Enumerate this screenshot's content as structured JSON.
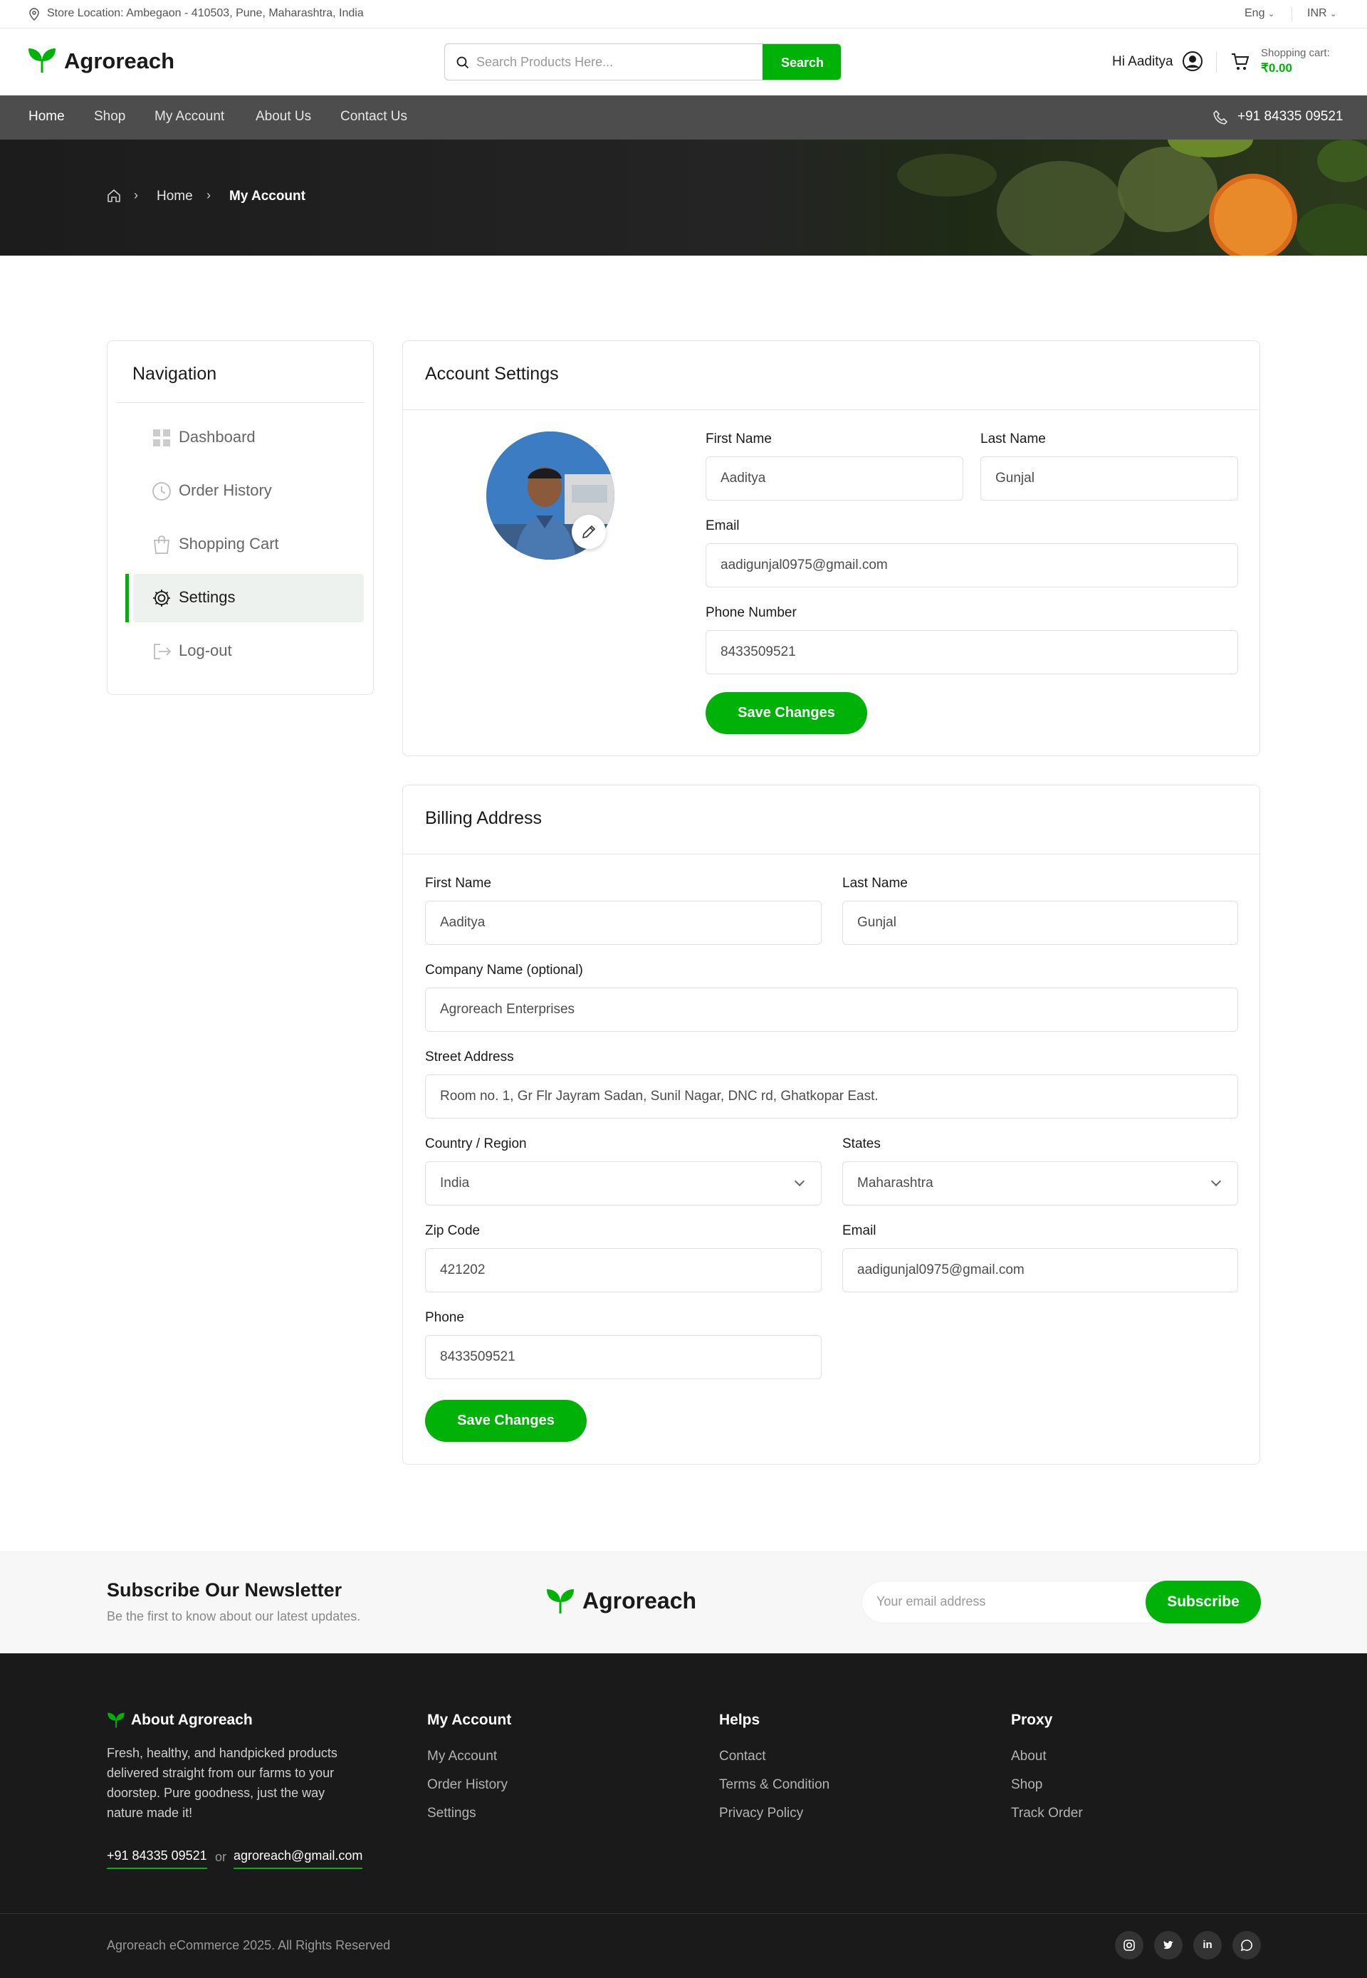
{
  "topbar": {
    "store_location": "Store Location: Ambegaon - 410503, Pune, Maharashtra, India",
    "language": "Eng",
    "currency": "INR"
  },
  "header": {
    "brand": "Agroreach",
    "search_placeholder": "Search Products Here...",
    "search_button": "Search",
    "greeting": "Hi Aaditya",
    "cart_label": "Shopping cart:",
    "cart_total": "₹0.00"
  },
  "nav": {
    "items": [
      "Home",
      "Shop",
      "My Account",
      "About Us",
      "Contact Us"
    ],
    "phone": "+91 84335 09521"
  },
  "breadcrumb": {
    "home": "Home",
    "current": "My Account"
  },
  "sidebar": {
    "title": "Navigation",
    "items": [
      {
        "label": "Dashboard",
        "icon": "dashboard-icon"
      },
      {
        "label": "Order History",
        "icon": "clock-icon"
      },
      {
        "label": "Shopping Cart",
        "icon": "bag-icon"
      },
      {
        "label": "Settings",
        "icon": "gear-icon",
        "active": true
      },
      {
        "label": "Log-out",
        "icon": "logout-icon"
      }
    ]
  },
  "account_settings": {
    "title": "Account Settings",
    "first_name_label": "First Name",
    "first_name": "Aaditya",
    "last_name_label": "Last Name",
    "last_name": "Gunjal",
    "email_label": "Email",
    "email": "aadigunjal0975@gmail.com",
    "phone_label": "Phone Number",
    "phone": "8433509521",
    "save_button": "Save Changes"
  },
  "billing": {
    "title": "Billing Address",
    "first_name_label": "First Name",
    "first_name": "Aaditya",
    "last_name_label": "Last Name",
    "last_name": "Gunjal",
    "company_label": "Company Name (optional)",
    "company": "Agroreach Enterprises",
    "street_label": "Street Address",
    "street": "Room no. 1, Gr Flr Jayram Sadan, Sunil Nagar, DNC rd, Ghatkopar East.",
    "country_label": "Country / Region",
    "country": "India",
    "state_label": "States",
    "state": "Maharashtra",
    "zip_label": "Zip Code",
    "zip": "421202",
    "email_label": "Email",
    "email": "aadigunjal0975@gmail.com",
    "phone_label": "Phone",
    "phone": "8433509521",
    "save_button": "Save Changes"
  },
  "newsletter": {
    "title": "Subscribe Our Newsletter",
    "subtitle": "Be the first to know about our latest updates.",
    "brand": "Agroreach",
    "email_placeholder": "Your email address",
    "subscribe_button": "Subscribe"
  },
  "footer": {
    "about_title": "About Agroreach",
    "about_text": "Fresh, healthy, and handpicked products delivered straight from our farms to your doorstep. Pure goodness, just the way nature made it!",
    "phone": "+91 84335 09521",
    "or": "or",
    "email": "agroreach@gmail.com",
    "columns": [
      {
        "title": "My Account",
        "links": [
          "My Account",
          "Order History",
          "Settings"
        ]
      },
      {
        "title": "Helps",
        "links": [
          "Contact",
          "Terms & Condition",
          "Privacy Policy"
        ]
      },
      {
        "title": "Proxy",
        "links": [
          "About",
          "Shop",
          "Track Order"
        ]
      }
    ],
    "copyright": "Agroreach eCommerce 2025. All Rights Reserved",
    "social": [
      "instagram-icon",
      "twitter-icon",
      "linkedin-icon",
      "whatsapp-icon"
    ]
  },
  "colors": {
    "brand_green": "#00b207",
    "nav_bg": "#4d4d4d",
    "footer_bg": "#1a1a1a"
  }
}
